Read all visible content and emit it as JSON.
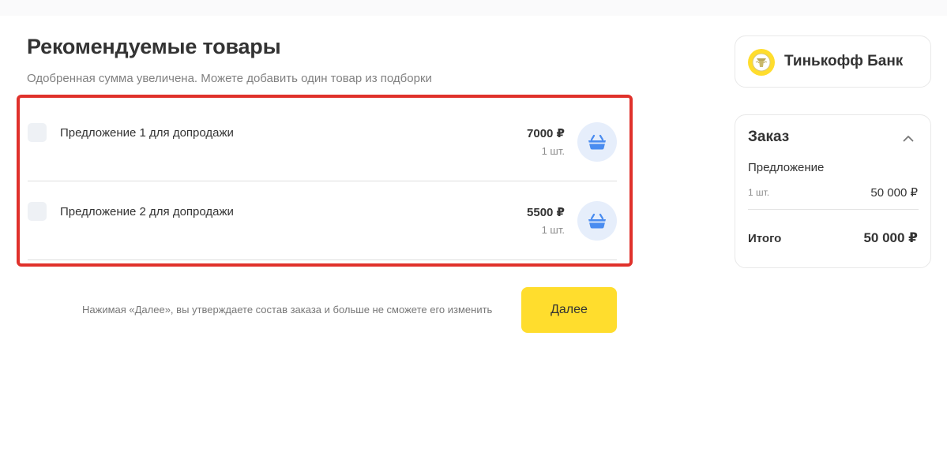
{
  "recommended": {
    "title": "Рекомендуемые товары",
    "subtitle": "Одобренная сумма увеличена. Можете добавить один товар из подборки",
    "offers": [
      {
        "name": "Предложение 1 для допродажи",
        "price": "7000 ₽",
        "qty": "1 шт."
      },
      {
        "name": "Предложение 2 для допродажи",
        "price": "5500 ₽",
        "qty": "1 шт."
      }
    ]
  },
  "footer": {
    "disclaimer": "Нажимая «Далее», вы утверждаете состав заказа и больше не сможете его изменить",
    "next_label": "Далее"
  },
  "bank": {
    "name": "Тинькофф Банк",
    "logo_icon": "tinkoff-emblem-icon"
  },
  "order": {
    "title": "Заказ",
    "item_name": "Предложение",
    "item_qty": "1 шт.",
    "item_price": "50 000 ₽",
    "total_label": "Итого",
    "total_value": "50 000 ₽"
  },
  "colors": {
    "accent_yellow": "#ffdd2d",
    "highlight_red": "#e0312b",
    "basket_blue": "#4a8cf0",
    "basket_bg": "#e6eefb"
  },
  "icons": {
    "basket": "basket-icon",
    "collapse": "chevron-up-icon"
  }
}
